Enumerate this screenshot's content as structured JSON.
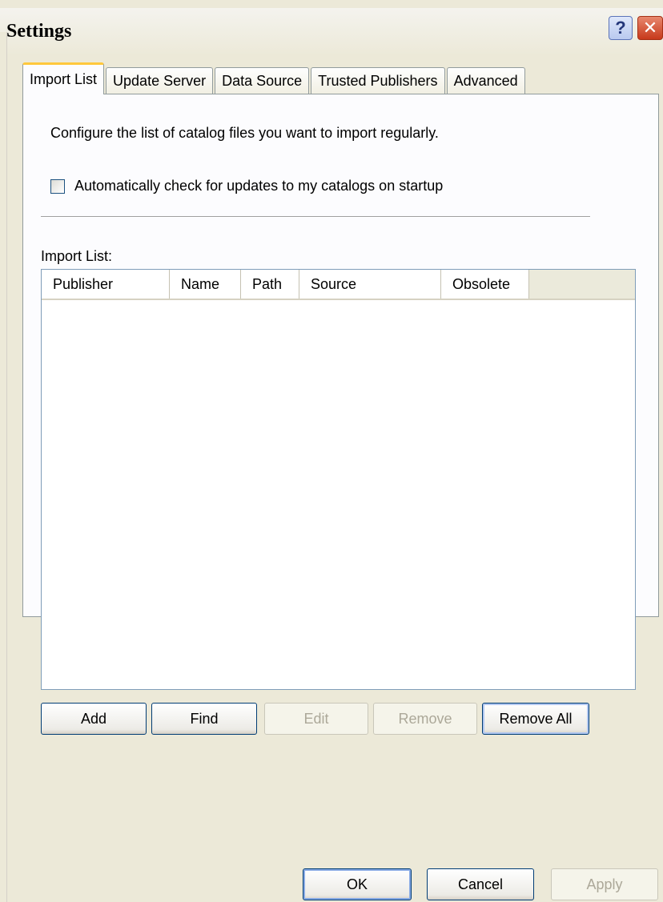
{
  "window": {
    "title": "Settings",
    "help_label": "?",
    "close_label": "✕"
  },
  "tabs": [
    {
      "label": "Import List",
      "active": true
    },
    {
      "label": "Update Server",
      "active": false
    },
    {
      "label": "Data Source",
      "active": false
    },
    {
      "label": "Trusted Publishers",
      "active": false
    },
    {
      "label": "Advanced",
      "active": false
    }
  ],
  "import_list_tab": {
    "description": "Configure the list of catalog files you want to import regularly.",
    "auto_check_label": "Automatically check for updates to my catalogs on startup",
    "auto_check_checked": false,
    "list_label": "Import List:",
    "columns": [
      "Publisher",
      "Name",
      "Path",
      "Source",
      "Obsolete"
    ],
    "rows": [],
    "buttons": {
      "add": "Add",
      "find": "Find",
      "edit": "Edit",
      "remove": "Remove",
      "remove_all": "Remove All"
    }
  },
  "dialog_buttons": {
    "ok": "OK",
    "cancel": "Cancel",
    "apply": "Apply"
  },
  "colors": {
    "dialog_bg": "#ece9d8",
    "panel_bg": "#fcfcfe",
    "tab_highlight": "#ffc83c",
    "button_border": "#003c74",
    "disabled_text": "#aca899"
  }
}
